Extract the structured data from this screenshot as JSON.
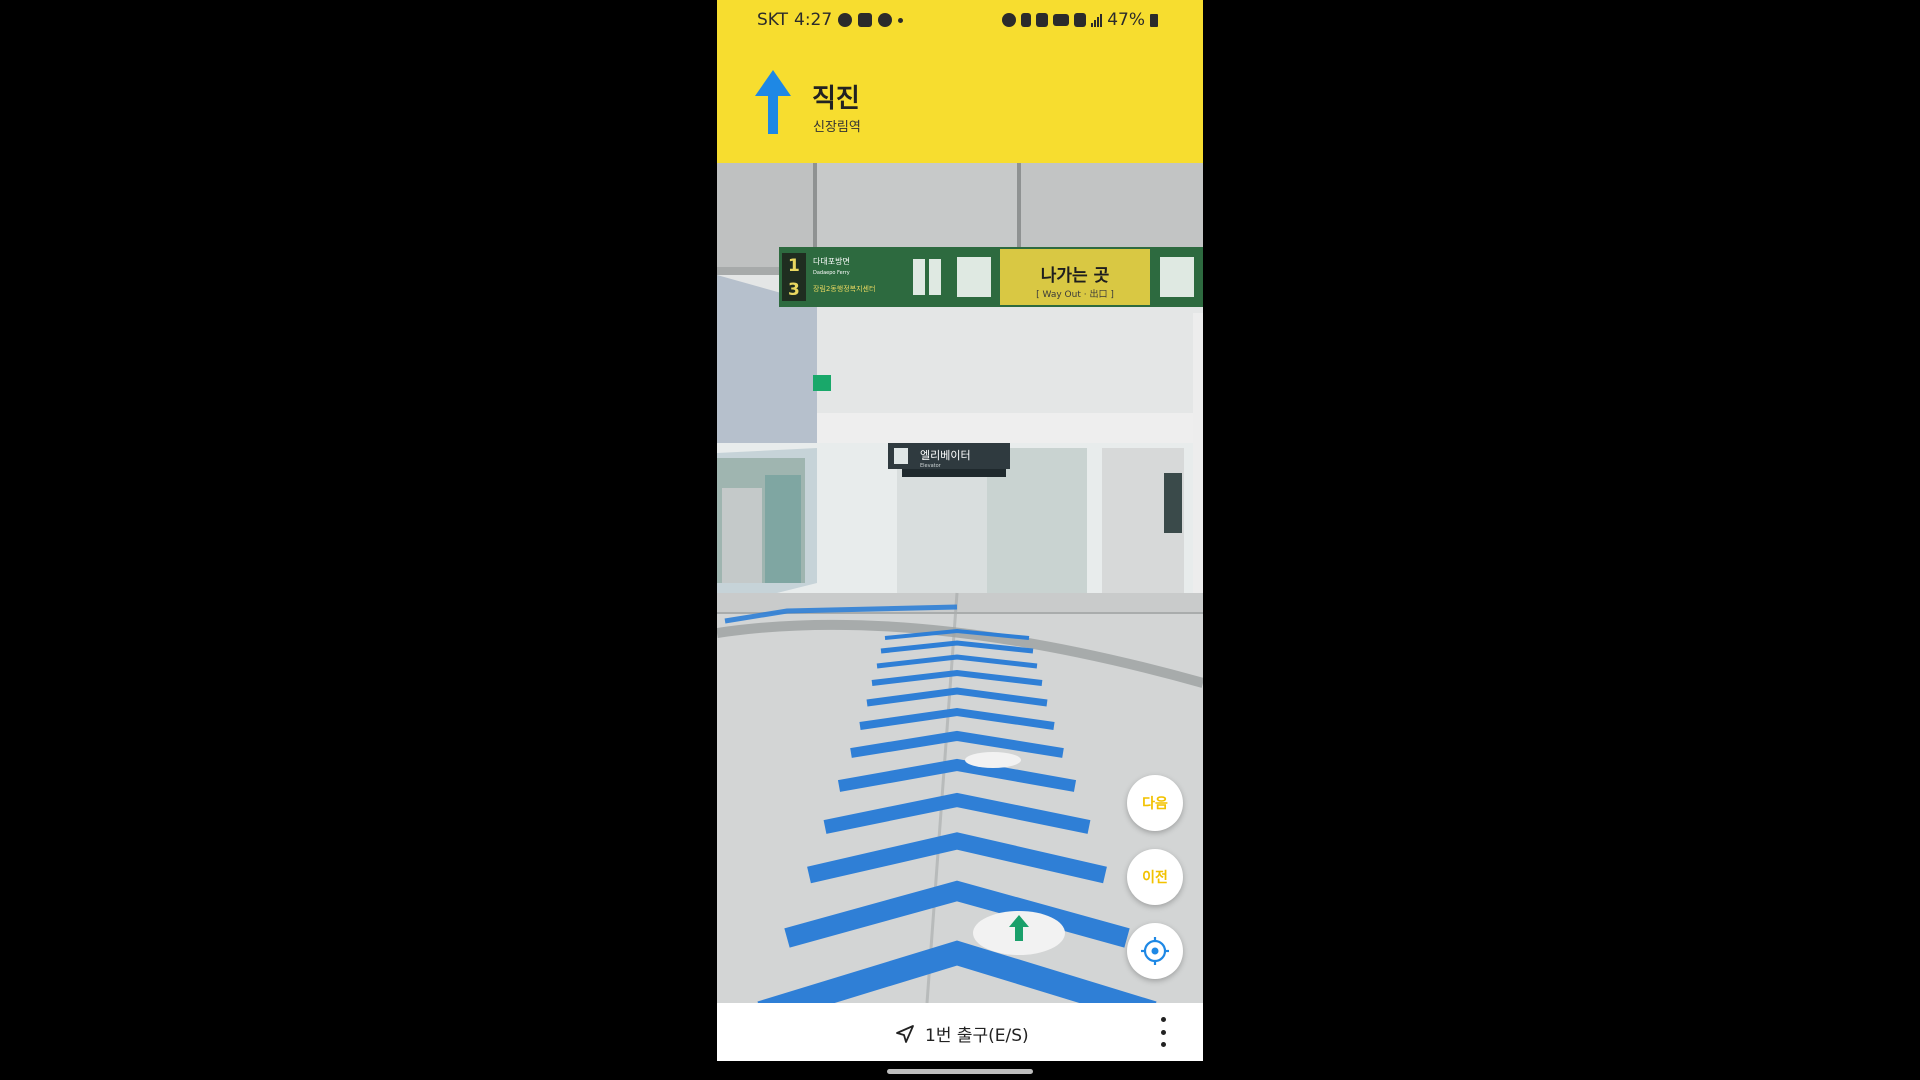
{
  "status_bar": {
    "carrier": "SKT",
    "time": "4:27",
    "battery": "47%",
    "icons_left": [
      "message-icon",
      "gallery-icon",
      "sync-icon",
      "dot"
    ],
    "icons_right": [
      "alarm-icon",
      "bluetooth-icon",
      "mute-icon",
      "volte-icon",
      "5g-icon",
      "signal-icon",
      "battery-icon"
    ]
  },
  "navigation": {
    "instruction": "직진",
    "station": "신장림역",
    "arrow_color": "#1e88e5",
    "header_color": "#f7dd2f"
  },
  "scene": {
    "sign_exit_numbers": [
      "1",
      "3"
    ],
    "sign_exit_text_1": "다대포방면",
    "sign_exit_text_1_en": "Dadaepo Ferry",
    "sign_exit_text_3": "장림2동행정복지센터",
    "sign_way_out": "나가는 곳",
    "sign_way_out_sub": "[ Way Out · 出口 ]",
    "elevator_sign": "엘리베이터",
    "elevator_sign_en": "Elevator",
    "path_color": "#2f7fd6"
  },
  "buttons": {
    "next": "다음",
    "prev": "이전",
    "locate": "locate-icon"
  },
  "bottom_bar": {
    "destination": "1번 출구(E/S)"
  }
}
